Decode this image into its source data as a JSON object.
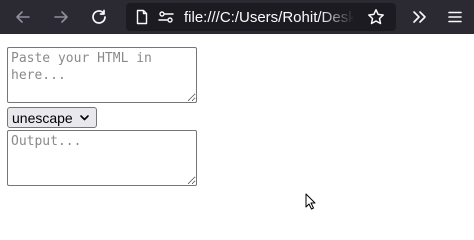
{
  "browser": {
    "url": "file:///C:/Users/Rohit/Desktop/",
    "icons": [
      "back-icon",
      "forward-icon",
      "reload-icon",
      "page-icon",
      "permissions-icon",
      "star-icon",
      "overflow-icon",
      "menu-icon"
    ]
  },
  "page": {
    "input": {
      "placeholder": "Paste your HTML in here...",
      "value": ""
    },
    "mode_select": {
      "selected": "unescape",
      "options": [
        "unescape"
      ]
    },
    "output": {
      "placeholder": "Output...",
      "value": ""
    }
  },
  "colors": {
    "toolbar_bg": "#2b2a33",
    "urlbar_bg": "#1c1b22",
    "toolbar_icon": "#fbfbfe",
    "disabled_icon": "#8f8f9d",
    "field_border": "#767676",
    "select_bg": "#e9e9ed"
  }
}
